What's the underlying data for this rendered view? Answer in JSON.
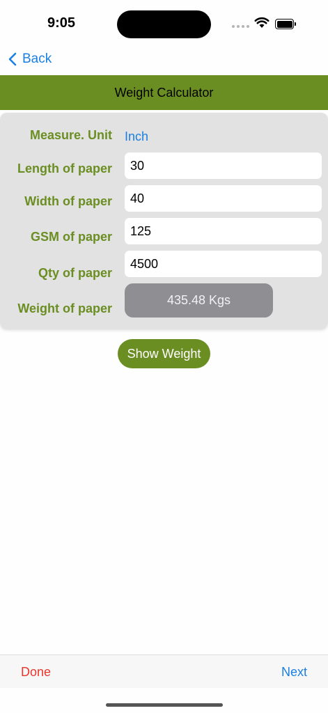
{
  "status_bar": {
    "time": "9:05"
  },
  "nav": {
    "back_label": "Back"
  },
  "header": {
    "title": "Weight Calculator"
  },
  "form": {
    "measure_unit": {
      "label": "Measure. Unit",
      "value": "Inch"
    },
    "length": {
      "label": "Length of paper",
      "value": "30"
    },
    "width": {
      "label": "Width of paper",
      "value": "40"
    },
    "gsm": {
      "label": "GSM of paper",
      "value": "125"
    },
    "qty": {
      "label": "Qty of paper",
      "value": "4500"
    },
    "weight": {
      "label": "Weight of paper",
      "value": "435.48 Kgs"
    }
  },
  "actions": {
    "show_weight_label": "Show Weight"
  },
  "toolbar": {
    "done_label": "Done",
    "next_label": "Next"
  },
  "colors": {
    "accent_green": "#6b8e23",
    "link_blue": "#1a7fe0",
    "destructive_red": "#e8362d"
  }
}
